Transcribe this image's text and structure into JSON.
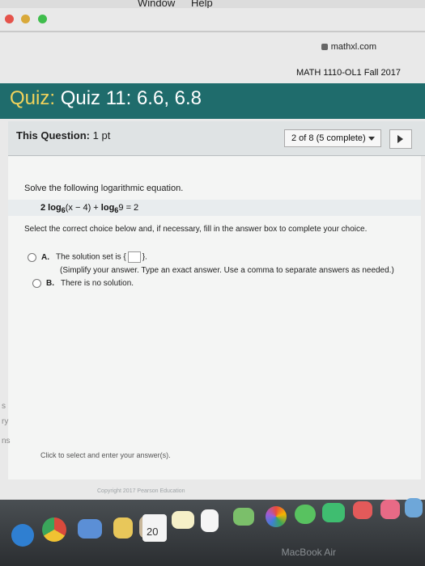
{
  "menubar": {
    "window_label": "Window",
    "help_label": "Help"
  },
  "browser": {
    "url": "mathxl.com"
  },
  "course": {
    "name": "MATH 1110-OL1 Fall 2017"
  },
  "quiz": {
    "prefix": "Quiz:",
    "title": "Quiz 11: 6.6, 6.8"
  },
  "question_bar": {
    "label": "This Question:",
    "points": "1 pt",
    "pager_text": "2 of 8 (5 complete)"
  },
  "question": {
    "prompt": "Solve the following logarithmic equation.",
    "eq_a": "2 log",
    "eq_sub1": "6",
    "eq_b": "(x − 4) +",
    "eq_c": " log",
    "eq_sub2": "6",
    "eq_d": "9 = 2",
    "instruction": "Select the correct choice below and, if necessary, fill in the answer box to complete your choice.",
    "choices": [
      {
        "letter": "A.",
        "text": "The solution set is {",
        "text_end": "}."
      },
      {
        "letter": "B.",
        "text": "There is no solution."
      }
    ],
    "choice_a_note": "(Simplify your answer. Type an exact answer. Use a comma to separate answers as needed.)",
    "footer": "Click to select and enter your answer(s)."
  },
  "copyright": "Copyright 2017 Pearson Education",
  "side_labels": [
    "s",
    "ry",
    "ns"
  ],
  "dock": {
    "calendar_day": "20"
  },
  "device_label": "MacBook Air"
}
